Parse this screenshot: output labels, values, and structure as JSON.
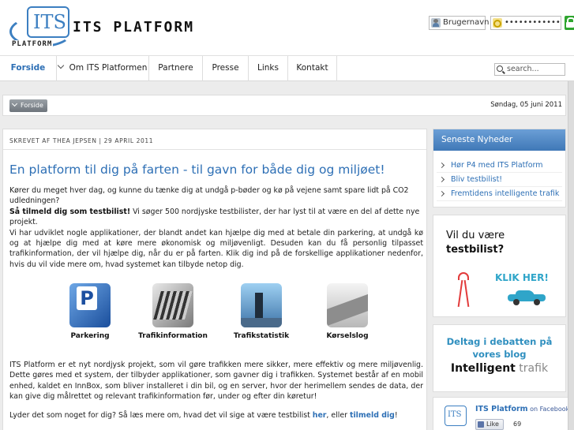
{
  "header": {
    "logo_text": "ITS",
    "logo_sub": "PLATFORM",
    "site_title": "ITS PLATFORM"
  },
  "login": {
    "username_placeholder": "Brugernavn",
    "password_value": "••••••••••••"
  },
  "nav": {
    "items": [
      {
        "label": "Forside"
      },
      {
        "label": "Om ITS Platformen"
      },
      {
        "label": "Partnere"
      },
      {
        "label": "Presse"
      },
      {
        "label": "Links"
      },
      {
        "label": "Kontakt"
      }
    ],
    "search_placeholder": "search..."
  },
  "breadcrumb": {
    "label": "Forside",
    "date": "Søndag, 05 juni 2011"
  },
  "article": {
    "byline": "SKREVET AF THEA JEPSEN | 29 APRIL 2011",
    "headline": "En platform til dig på farten - til gavn for både dig og miljøet!",
    "p1": "Kører du meget hver dag, og kunne du tænke dig at undgå p-bøder og kø på vejene samt spare lidt på CO2 udledningen?",
    "p2_bold": "Så tilmeld dig som testbilist!",
    "p2_rest": " Vi søger 500 nordjyske testbilister, der har lyst til at være en del af dette nye projekt.",
    "p3": "Vi har udviklet nogle applikationer, der blandt andet kan hjælpe dig med at betale din parkering, at undgå kø og at hjælpe dig med at køre mere økonomisk og miljøvenligt. Desuden kan du få personlig tilpasset trafikinformation, der vil hjælpe dig, når du er på farten. Klik dig ind på de forskellige applikationer nedenfor, hvis du vil vide mere om, hvad systemet kan tilbyde netop dig.",
    "apps": [
      {
        "label": "Parkering",
        "icon": "parking-icon"
      },
      {
        "label": "Trafikinformation",
        "icon": "traffic-info-icon"
      },
      {
        "label": "Trafikstatistik",
        "icon": "traffic-stats-icon"
      },
      {
        "label": "Kørselslog",
        "icon": "driving-log-icon"
      }
    ],
    "p4": "ITS Platform er et nyt nordjysk projekt, som vil gøre trafikken mere sikker, mere effektiv og mere miljøvenlig. Dette gøres med et system, der tilbyder applikationer, som gavner dig i trafikken. Systemet består af en mobil enhed, kaldet en InnBox, som bliver installeret i din bil, og en server, hvor der herimellem sendes de data, der kan give dig målrettet og relevant trafikinformation før, under og efter din køretur!",
    "cta_prefix": "Lyder det som noget for dig? Så læs mere om, hvad det vil sige at være testbilist ",
    "cta_link1": "her",
    "cta_mid": ", eller ",
    "cta_link2": "tilmeld dig",
    "cta_suffix": "!"
  },
  "sidebar": {
    "news_title": "Seneste Nyheder",
    "news_items": [
      {
        "label": "Hør P4 med ITS Platform"
      },
      {
        "label": "Bliv testbilist!"
      },
      {
        "label": "Fremtidens intelligente trafik"
      }
    ],
    "ad": {
      "line1": "Vil du være",
      "line2": "testbilist?",
      "cta": "KLIK HER!"
    },
    "blog": {
      "line1": "Deltag i debatten på",
      "line2": "vores blog",
      "brand_bold": "Intelligent",
      "brand_light": " trafik"
    },
    "facebook": {
      "page_name": "ITS Platform",
      "on_text": " on Facebook",
      "like_label": "Like",
      "like_count": "69",
      "logo_text": "ITS"
    }
  },
  "colors": {
    "accent": "#2d6fb5",
    "header_blue": "#3f78b7",
    "cta_teal": "#2fa5c9"
  }
}
